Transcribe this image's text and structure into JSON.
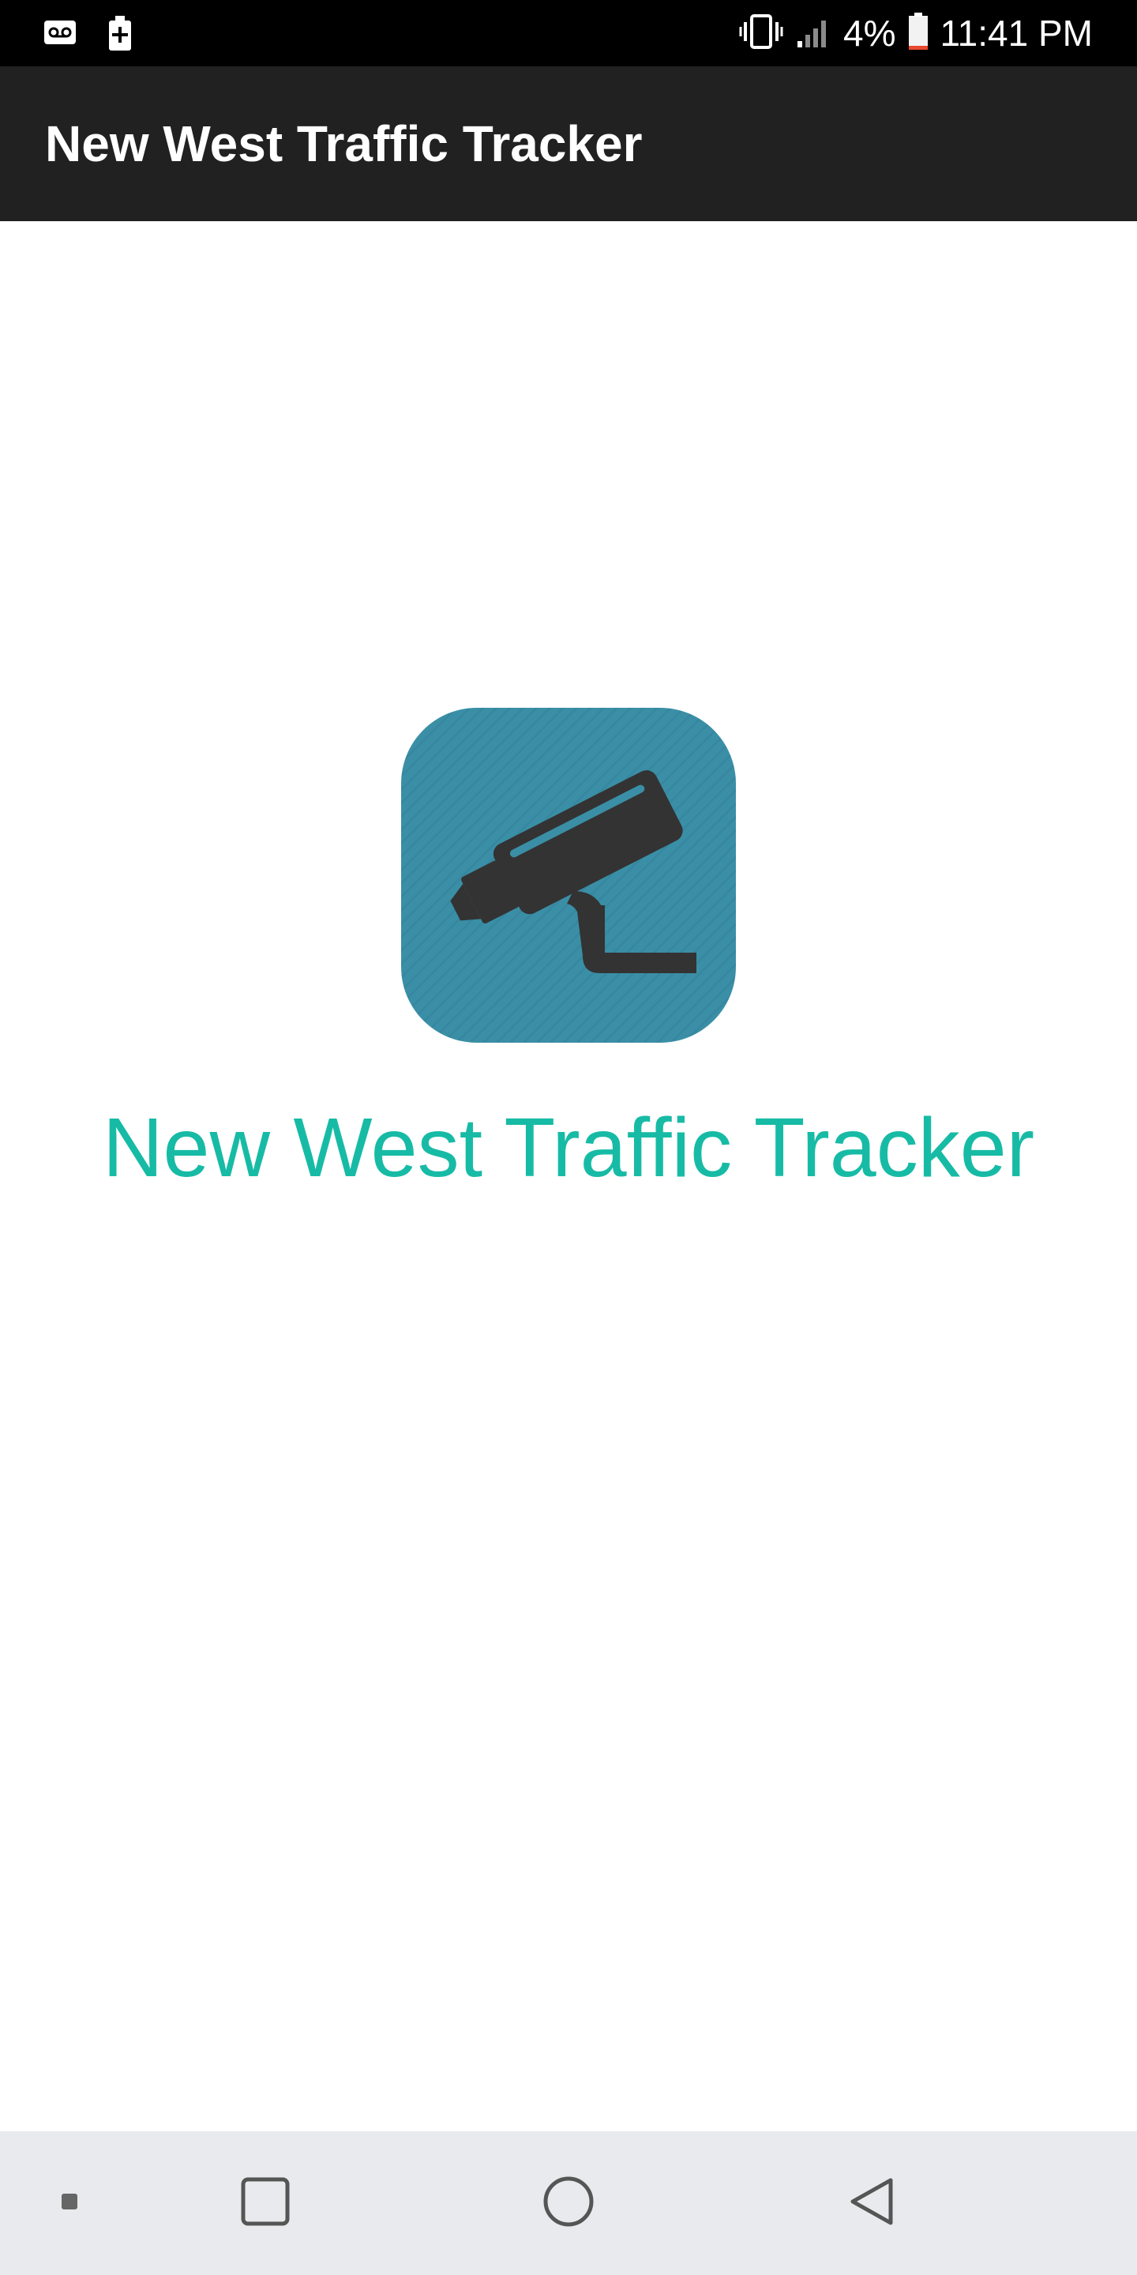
{
  "status_bar": {
    "battery_percent": "4%",
    "time": "11:41 PM",
    "icons": [
      "voicemail-icon",
      "battery-saver-icon",
      "vibrate-icon",
      "signal-icon",
      "battery-icon"
    ]
  },
  "app_bar": {
    "title": "New West Traffic Tracker"
  },
  "splash": {
    "icon": "security-camera-icon",
    "title": "New West Traffic Tracker",
    "colors": {
      "title": "#17bba5",
      "icon_background": "#3a8fa6",
      "icon_foreground": "#333333"
    }
  },
  "nav_bar": {
    "buttons": [
      "dot-icon",
      "recents-icon",
      "home-icon",
      "back-icon"
    ]
  }
}
